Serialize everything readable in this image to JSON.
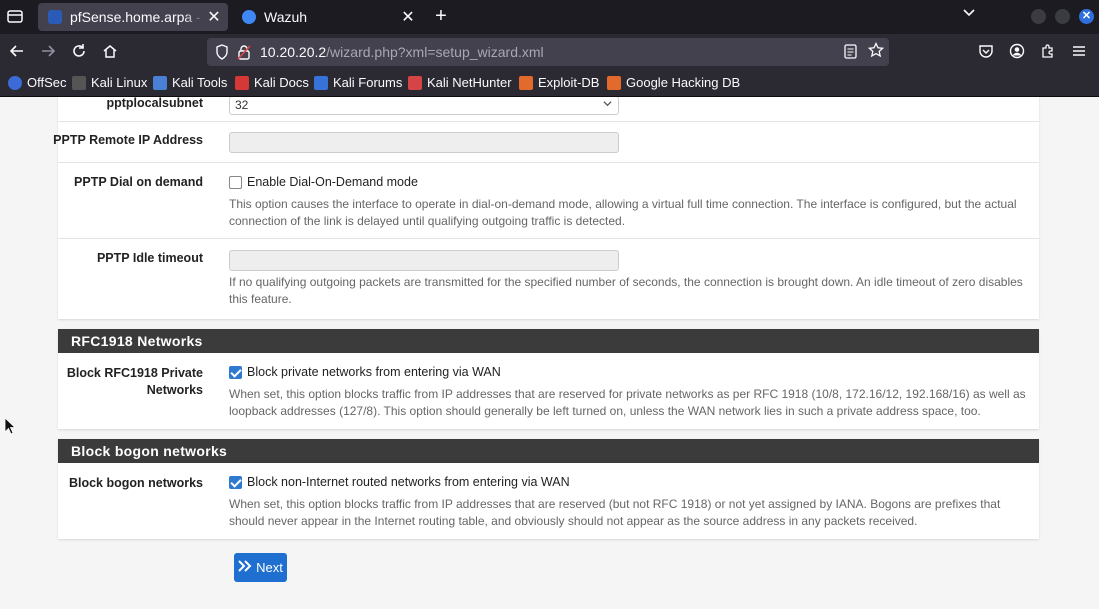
{
  "browser": {
    "tabs": [
      {
        "title": "pfSense.home.arpa - Wizard",
        "active": true
      },
      {
        "title": "Wazuh",
        "active": false
      }
    ],
    "new_tab": "+",
    "close_glyph": "✕",
    "url_host": "10.20.20.2",
    "url_path": "/wizard.php?xml=setup_wizard.xml",
    "bookmarks": [
      {
        "label": "OffSec",
        "icon": "offsec-icon",
        "color": "#3c6bd8"
      },
      {
        "label": "Kali Linux",
        "icon": "kali-dragon-icon",
        "color": "#2b2a33"
      },
      {
        "label": "Kali Tools",
        "icon": "kali-tools-icon",
        "color": "#4a7fd6"
      },
      {
        "label": "Kali Docs",
        "icon": "kali-docs-icon",
        "color": "#d63737"
      },
      {
        "label": "Kali Forums",
        "icon": "kali-forums-icon",
        "color": "#3672d8"
      },
      {
        "label": "Kali NetHunter",
        "icon": "nethunter-icon",
        "color": "#d64545"
      },
      {
        "label": "Exploit-DB",
        "icon": "exploit-db-icon",
        "color": "#e26a2c"
      },
      {
        "label": "Google Hacking DB",
        "icon": "ghdb-icon",
        "color": "#e26a2c"
      }
    ],
    "accent": "#2f6fdb"
  },
  "form": {
    "pptp_local_subnet": {
      "label": "pptplocalsubnet",
      "value": "32"
    },
    "pptp_remote_ip": {
      "label": "PPTP Remote IP Address",
      "value": ""
    },
    "pptp_dial_on_demand": {
      "label": "PPTP Dial on demand",
      "checkbox_label": "Enable Dial-On-Demand mode",
      "checked": false,
      "help_line1": "This option causes the interface to operate in dial-on-demand mode, allowing a virtual full time connection. The interface is configured, but the actual",
      "help_line2": "connection of the link is delayed until qualifying outgoing traffic is detected."
    },
    "pptp_idle_timeout": {
      "label": "PPTP Idle timeout",
      "value": "",
      "help_line1": "If no qualifying outgoing packets are transmitted for the specified number of seconds, the connection is brought down. An idle timeout of zero disables",
      "help_line2": "this feature."
    },
    "rfc1918_section": {
      "title": "RFC1918 Networks",
      "label_line1": "Block RFC1918 Private",
      "label_line2": "Networks",
      "checkbox_label": "Block private networks from entering via WAN",
      "checked": true,
      "help_line1": "When set, this option blocks traffic from IP addresses that are reserved for private networks as per RFC 1918 (10/8, 172.16/12, 192.168/16) as well as",
      "help_line2": "loopback addresses (127/8). This option should generally be left turned on, unless the WAN network lies in such a private address space, too."
    },
    "bogon_section": {
      "title": "Block bogon networks",
      "label": "Block bogon networks",
      "checkbox_label": "Block non-Internet routed networks from entering via WAN",
      "checked": true,
      "help_line1": "When set, this option blocks traffic from IP addresses that are reserved (but not RFC 1918) or not yet assigned by IANA. Bogons are prefixes that",
      "help_line2": "should never appear in the Internet routing table, and obviously should not appear as the source address in any packets received."
    },
    "next_button": "Next",
    "section_header_color": "#3b3b3b",
    "button_color": "#1e6fd0"
  }
}
